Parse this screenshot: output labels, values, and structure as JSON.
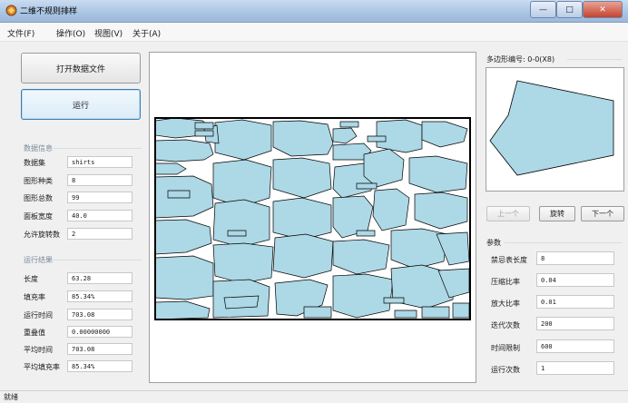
{
  "window": {
    "title": "二维不规则排样"
  },
  "menu": [
    "文件(F)",
    "操作(O)",
    "视图(V)",
    "关于(A)"
  ],
  "buttons": {
    "open_file": "打开数据文件",
    "run": "运行"
  },
  "data_info": {
    "title": "数据信息",
    "rows": [
      {
        "label": "数据集",
        "value": "shirts"
      },
      {
        "label": "图形种类",
        "value": "8"
      },
      {
        "label": "图形总数",
        "value": "99"
      },
      {
        "label": "面板宽度",
        "value": "40.0"
      },
      {
        "label": "允许旋转数",
        "value": "2"
      }
    ]
  },
  "run_results": {
    "title": "运行结果",
    "rows": [
      {
        "label": "长度",
        "value": "63.28"
      },
      {
        "label": "填充率",
        "value": "85.34%"
      },
      {
        "label": "运行时间",
        "value": "703.08"
      },
      {
        "label": "重叠值",
        "value": "0.00000000"
      },
      {
        "label": "平均时间",
        "value": "703.08"
      },
      {
        "label": "平均填充率",
        "value": "85.34%"
      }
    ]
  },
  "preview": {
    "title": "多边形编号: 0-0(X8)"
  },
  "nav": {
    "prev": "上一个",
    "rotate": "旋转",
    "next": "下一个"
  },
  "params": {
    "title": "参数",
    "rows": [
      {
        "label": "禁忌表长度",
        "value": "8"
      },
      {
        "label": "压缩比率",
        "value": "0.04"
      },
      {
        "label": "放大比率",
        "value": "0.01"
      },
      {
        "label": "迭代次数",
        "value": "200"
      },
      {
        "label": "时间限制",
        "value": "600"
      },
      {
        "label": "运行次数",
        "value": "1"
      }
    ]
  },
  "status": {
    "text": "就绪"
  },
  "colors": {
    "piece_fill": "#add8e6",
    "piece_stroke": "#000000",
    "accent": "#3c7fb1"
  }
}
